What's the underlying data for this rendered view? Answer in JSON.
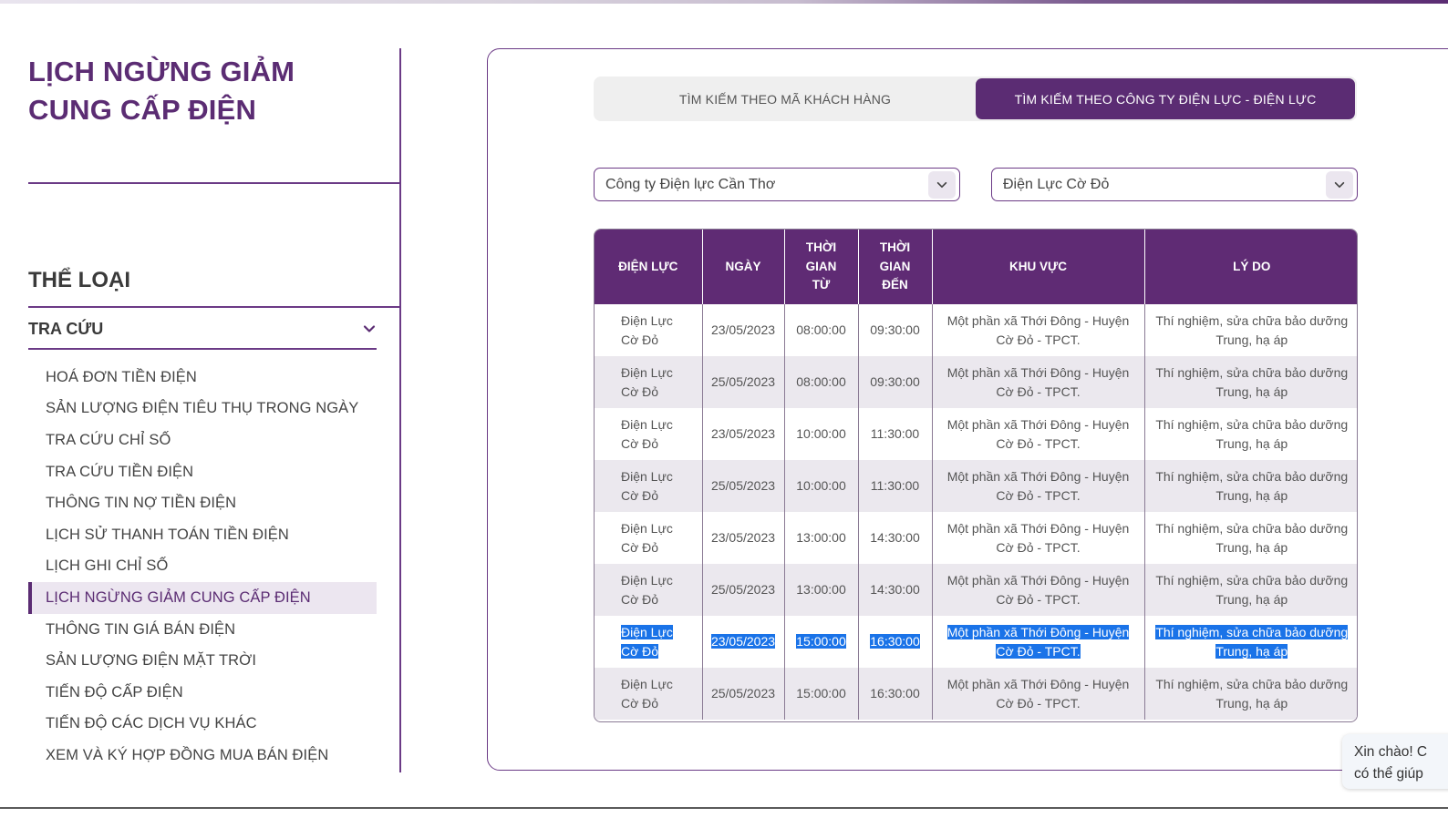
{
  "sidebar": {
    "page_title": "LỊCH NGỪNG GIẢM CUNG CẤP ĐIỆN",
    "section_heading": "THỂ LOẠI",
    "accordion_label": "TRA CỨU",
    "items": [
      {
        "label": "HOÁ ĐƠN TIỀN ĐIỆN"
      },
      {
        "label": "SẢN LƯỢNG ĐIỆN TIÊU THỤ TRONG NGÀY"
      },
      {
        "label": "TRA CỨU CHỈ SỐ"
      },
      {
        "label": "TRA CỨU TIỀN ĐIỆN"
      },
      {
        "label": "THÔNG TIN NỢ TIỀN ĐIỆN"
      },
      {
        "label": "LỊCH SỬ THANH TOÁN TIỀN ĐIỆN"
      },
      {
        "label": "LỊCH GHI CHỈ SỐ"
      },
      {
        "label": "LỊCH NGỪNG GIẢM CUNG CẤP ĐIỆN"
      },
      {
        "label": "THÔNG TIN GIÁ BÁN ĐIỆN"
      },
      {
        "label": "SẢN LƯỢNG ĐIỆN MẶT TRỜI"
      },
      {
        "label": "TIẾN ĐỘ CẤP ĐIỆN"
      },
      {
        "label": "TIẾN ĐỘ CÁC DỊCH VỤ KHÁC"
      },
      {
        "label": "XEM VÀ KÝ HỢP ĐỒNG MUA BÁN ĐIỆN"
      }
    ],
    "active_index": 7
  },
  "tabs": [
    {
      "label": "TÌM KIẾM THEO MÃ KHÁCH HÀNG",
      "active": false
    },
    {
      "label": "TÌM KIẾM THEO CÔNG TY ĐIỆN LỰC - ĐIỆN LỰC",
      "active": true
    }
  ],
  "filters": {
    "company": "Công ty Điện lực Cần Thơ",
    "branch": "Điện Lực Cờ Đỏ"
  },
  "table": {
    "headers": {
      "dien_luc": "ĐIỆN LỰC",
      "ngay": "NGÀY",
      "tu_1": "THỜI",
      "tu_2": "GIAN",
      "tu_3": "TỪ",
      "den_1": "THỜI",
      "den_2": "GIAN",
      "den_3": "ĐẾN",
      "khu_vuc": "KHU VỰC",
      "ly_do": "LÝ DO"
    },
    "rows": [
      {
        "dl1": "Điện Lực",
        "dl2": "Cờ Đỏ",
        "ngay": "23/05/2023",
        "tu": "08:00:00",
        "den": "09:30:00",
        "kv1": "Một phần xã Thới Đông - Huyện",
        "kv2": "Cờ Đỏ - TPCT.",
        "ld1": "Thí nghiệm, sửa chữa bảo dưỡng",
        "ld2": "Trung, hạ áp"
      },
      {
        "dl1": "Điện Lực",
        "dl2": "Cờ Đỏ",
        "ngay": "25/05/2023",
        "tu": "08:00:00",
        "den": "09:30:00",
        "kv1": "Một phần xã Thới Đông - Huyện",
        "kv2": "Cờ Đỏ - TPCT.",
        "ld1": "Thí nghiệm, sửa chữa bảo dưỡng",
        "ld2": "Trung, hạ áp"
      },
      {
        "dl1": "Điện Lực",
        "dl2": "Cờ Đỏ",
        "ngay": "23/05/2023",
        "tu": "10:00:00",
        "den": "11:30:00",
        "kv1": "Một phần xã Thới Đông - Huyện",
        "kv2": "Cờ Đỏ - TPCT.",
        "ld1": "Thí nghiệm, sửa chữa bảo dưỡng",
        "ld2": "Trung, hạ áp"
      },
      {
        "dl1": "Điện Lực",
        "dl2": "Cờ Đỏ",
        "ngay": "25/05/2023",
        "tu": "10:00:00",
        "den": "11:30:00",
        "kv1": "Một phần xã Thới Đông - Huyện",
        "kv2": "Cờ Đỏ - TPCT.",
        "ld1": "Thí nghiệm, sửa chữa bảo dưỡng",
        "ld2": "Trung, hạ áp"
      },
      {
        "dl1": "Điện Lực",
        "dl2": "Cờ Đỏ",
        "ngay": "23/05/2023",
        "tu": "13:00:00",
        "den": "14:30:00",
        "kv1": "Một phần xã Thới Đông - Huyện",
        "kv2": "Cờ Đỏ - TPCT.",
        "ld1": "Thí nghiệm, sửa chữa bảo dưỡng",
        "ld2": "Trung, hạ áp"
      },
      {
        "dl1": "Điện Lực",
        "dl2": "Cờ Đỏ",
        "ngay": "25/05/2023",
        "tu": "13:00:00",
        "den": "14:30:00",
        "kv1": "Một phần xã Thới Đông - Huyện",
        "kv2": "Cờ Đỏ - TPCT.",
        "ld1": "Thí nghiệm, sửa chữa bảo dưỡng",
        "ld2": "Trung, hạ áp"
      },
      {
        "dl1": "Điện Lực",
        "dl2": "Cờ Đỏ",
        "ngay": "23/05/2023",
        "tu": "15:00:00",
        "den": "16:30:00",
        "kv1": "Một phần xã Thới Đông - Huyện",
        "kv2": "Cờ Đỏ - TPCT.",
        "ld1": "Thí nghiệm, sửa chữa bảo dưỡng",
        "ld2": "Trung, hạ áp"
      },
      {
        "dl1": "Điện Lực",
        "dl2": "Cờ Đỏ",
        "ngay": "25/05/2023",
        "tu": "15:00:00",
        "den": "16:30:00",
        "kv1": "Một phần xã Thới Đông - Huyện",
        "kv2": "Cờ Đỏ - TPCT.",
        "ld1": "Thí nghiệm, sửa chữa bảo dưỡng",
        "ld2": "Trung, hạ áp"
      }
    ],
    "selected_row": 6
  },
  "chat": {
    "line1": "Xin chào! C",
    "line2": "có thể giúp"
  },
  "colors": {
    "brand_purple": "#5b2c73",
    "selection_blue": "#1a73e8"
  },
  "icons": {
    "accordion": "chevron-down-icon",
    "select": "chevron-down-icon"
  }
}
